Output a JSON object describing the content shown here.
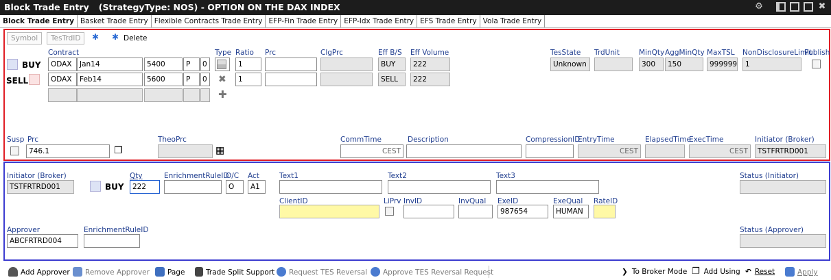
{
  "window": {
    "title": "Block Trade Entry",
    "strategy": "(StrategyType: NOS) - OPTION ON THE DAX INDEX"
  },
  "tabs": [
    "Block Trade Entry",
    "Basket Trade Entry",
    "Flexible Contracts Trade Entry",
    "EFP-Fin Trade Entry",
    "EFP-Idx Trade Entry",
    "EFS Trade Entry",
    "Vola Trade Entry"
  ],
  "toolbar": {
    "symbol": "Symbol",
    "testrdid": "TesTrdID",
    "delete": "Delete"
  },
  "legs_header": {
    "contract": "Contract",
    "type": "Type",
    "ratio": "Ratio",
    "prc": "Prc",
    "clgprc": "ClgPrc",
    "effbs": "Eff B/S",
    "effvolume": "Eff Volume",
    "tesstate": "TesState",
    "trdunit": "TrdUnit",
    "minqty": "MinQty",
    "aggminqty": "AggMinQty",
    "maxtsl": "MaxTSL",
    "nondisclosure": "NonDisclosureLimit",
    "publish": "Publish"
  },
  "legs": [
    {
      "side": "BUY",
      "product": "ODAX",
      "expiry": "Jan14",
      "strike": "5400",
      "cp": "P",
      "ver": "0",
      "ratio": "1",
      "effbs": "BUY",
      "effvol": "222"
    },
    {
      "side": "SELL",
      "product": "ODAX",
      "expiry": "Feb14",
      "strike": "5600",
      "cp": "P",
      "ver": "0",
      "ratio": "1",
      "effbs": "SELL",
      "effvol": "222"
    }
  ],
  "state": {
    "tesstate": "Unknown",
    "minqty": "300",
    "aggminqty": "150",
    "maxtsl": "999999",
    "nondisclosure": "1"
  },
  "trade": {
    "susp": "Susp",
    "prc_label": "Prc",
    "prc": "746.1",
    "theoprc": "TheoPrc",
    "commtime": "CommTime",
    "commtime_tz": "CEST",
    "description": "Description",
    "compressionid": "CompressionID",
    "entrytime": "EntryTime",
    "entrytime_tz": "CEST",
    "elapsedtime": "ElapsedTime",
    "exectime": "ExecTime",
    "exectime_tz": "CEST",
    "initiator_label": "Initiator (Broker)",
    "initiator": "TSTFRTRD001"
  },
  "party": {
    "initiator_label": "Initiator (Broker)",
    "initiator": "TSTFRTRD001",
    "side": "BUY",
    "qty_label": "Qty",
    "qty": "222",
    "enrichment_label": "EnrichmentRuleID",
    "oc_label": "O/C",
    "oc": "O",
    "act_label": "Act",
    "act": "A1",
    "text1": "Text1",
    "text2": "Text2",
    "text3": "Text3",
    "status_initiator": "Status (Initiator)",
    "clientid": "ClientID",
    "liprv": "LiPrv",
    "invid": "InvID",
    "invqual": "InvQual",
    "exeid_label": "ExeID",
    "exeid": "987654",
    "exequal_label": "ExeQual",
    "exequal": "HUMAN",
    "rateid": "RateID",
    "approver_label": "Approver",
    "approver": "ABCFRTRD004",
    "enrichment2_label": "EnrichmentRuleID",
    "status_approver": "Status (Approver)"
  },
  "bottom": {
    "add_approver": "Add Approver",
    "remove_approver": "Remove Approver",
    "page": "Page",
    "trade_split": "Trade Split Support",
    "request_reversal": "Request TES Reversal",
    "approve_reversal": "Approve TES Reversal Request",
    "to_broker": "To Broker Mode",
    "add_using": "Add Using",
    "reset": "Reset",
    "apply": "Apply"
  },
  "colors": {
    "accent_red": "#e01c24",
    "accent_blue": "#3b3bd0",
    "label_blue": "#1f3d8f",
    "highlight_yellow": "#fff9a6"
  }
}
